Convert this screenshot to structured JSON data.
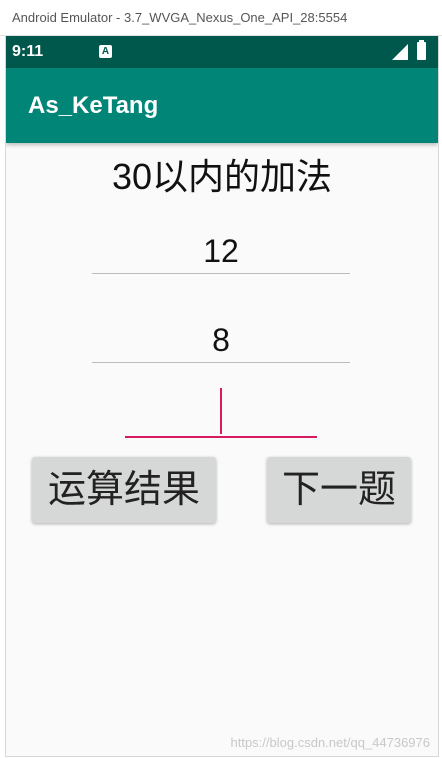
{
  "emulator": {
    "window_title": "Android Emulator - 3.7_WVGA_Nexus_One_API_28:5554"
  },
  "status_bar": {
    "time": "9:11",
    "notification_icon_letter": "A",
    "bg_color": "#00574b"
  },
  "app_bar": {
    "title": "As_KeTang",
    "bg_color": "#008577"
  },
  "main": {
    "heading": "30以内的加法",
    "first_number": "12",
    "second_number": "8",
    "answer_value": "",
    "accent_color": "#d81b60"
  },
  "buttons": {
    "calc_label": "运算结果",
    "next_label": "下一题"
  },
  "watermark": "https://blog.csdn.net/qq_44736976"
}
